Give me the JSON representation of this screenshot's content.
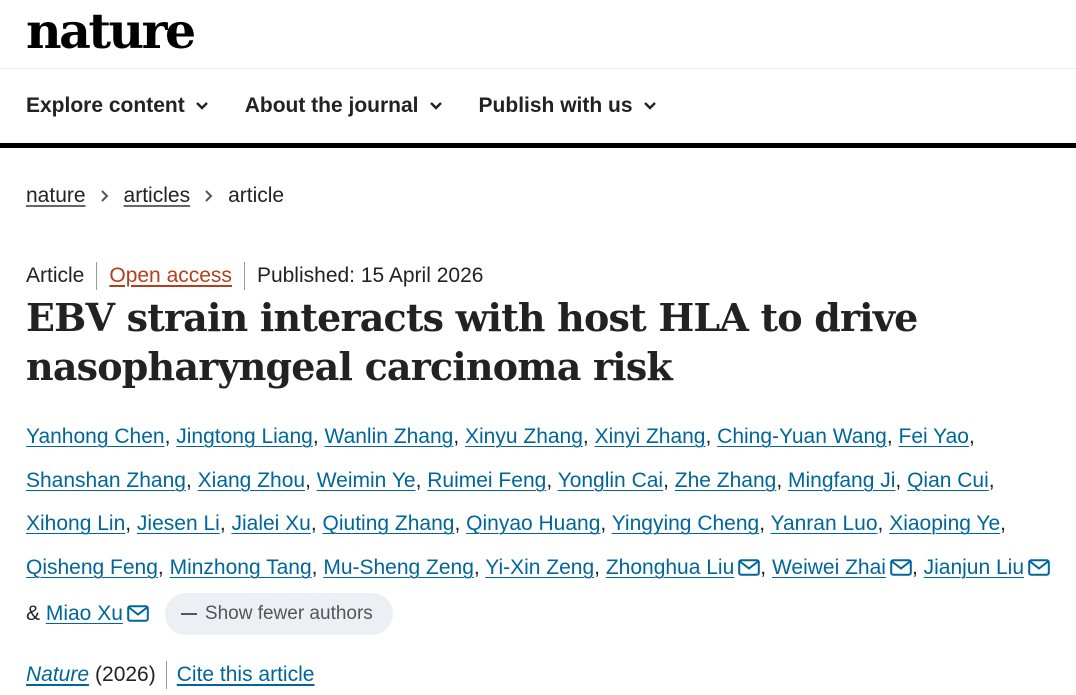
{
  "site": {
    "logo": "nature"
  },
  "nav": [
    {
      "label": "Explore content"
    },
    {
      "label": "About the journal"
    },
    {
      "label": "Publish with us"
    }
  ],
  "breadcrumb": {
    "items": [
      "nature",
      "articles"
    ],
    "current": "article"
  },
  "article": {
    "type": "Article",
    "access": "Open access",
    "published": "Published: 15 April 2026",
    "title": "EBV strain interacts with host HLA to drive nasopharyngeal carcinoma risk",
    "authors": [
      "Yanhong Chen",
      "Jingtong Liang",
      "Wanlin Zhang",
      "Xinyu Zhang",
      "Xinyi Zhang",
      "Ching-Yuan Wang",
      "Fei Yao",
      "Shanshan Zhang",
      "Xiang Zhou",
      "Weimin Ye",
      "Ruimei Feng",
      "Yonglin Cai",
      "Zhe Zhang",
      "Mingfang Ji",
      "Qian Cui",
      "Xihong Lin",
      "Jiesen Li",
      "Jialei Xu",
      "Qiuting Zhang",
      "Qinyao Huang",
      "Yingying Cheng",
      "Yanran Luo",
      "Xiaoping Ye",
      "Qisheng Feng",
      "Minzhong Tang",
      "Mu-Sheng Zeng",
      "Yi-Xin Zeng",
      "Zhonghua Liu",
      "Weiwei Zhai",
      "Jianjun Liu",
      "Miao Xu"
    ],
    "corresponding": [
      "Zhonghua Liu",
      "Weiwei Zhai",
      "Jianjun Liu",
      "Miao Xu"
    ],
    "show_fewer_label": "Show fewer authors",
    "journal": "Nature",
    "year": "(2026)",
    "cite_label": "Cite this article"
  },
  "colors": {
    "link": "#006699",
    "open_access": "#b43e1c",
    "nav_rule": "#000000",
    "pill_bg": "#eceff3"
  },
  "icons": [
    "chevron-down-icon",
    "chevron-right-icon",
    "mail-icon",
    "minus-icon"
  ]
}
